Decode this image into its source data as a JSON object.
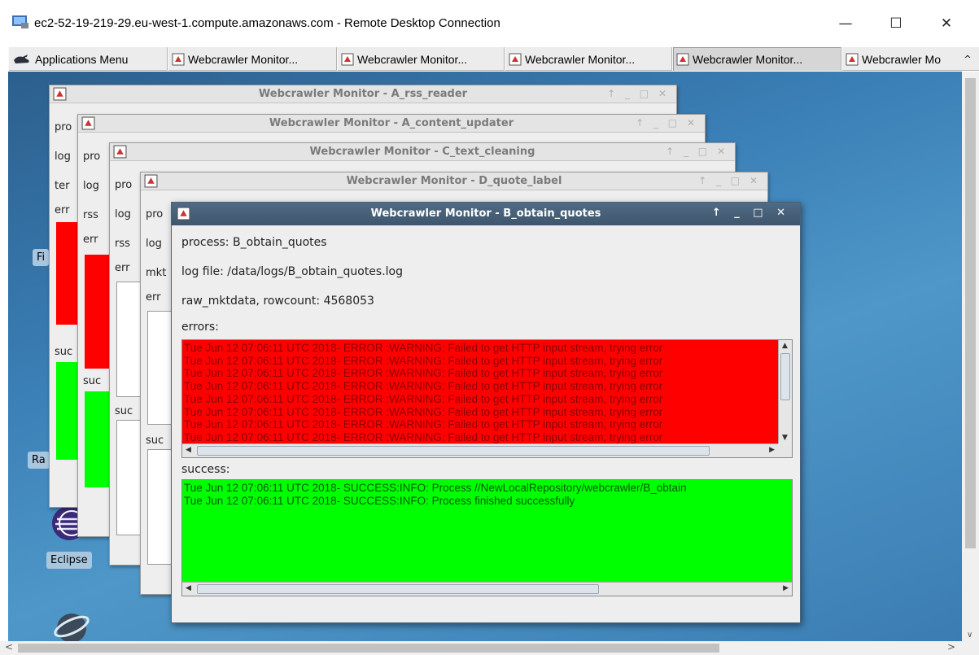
{
  "rdp": {
    "title": "ec2-52-19-219-29.eu-west-1.compute.amazonaws.com - Remote Desktop Connection",
    "minimize": "—",
    "maximize": "☐",
    "close": "✕"
  },
  "taskbar": {
    "apps_menu": "Applications Menu",
    "tasks": [
      "Webcrawler Monitor...",
      "Webcrawler Monitor...",
      "Webcrawler Monitor...",
      "Webcrawler Monitor...",
      "Webcrawler Mo"
    ]
  },
  "desktop": {
    "icons": [
      {
        "label": "Fi"
      },
      {
        "label": "Ra"
      },
      {
        "label": "Eclipse"
      }
    ]
  },
  "windows": {
    "w1": {
      "title": "Webcrawler Monitor - A_rss_reader",
      "peeks": [
        "pro",
        "log",
        "ter",
        "err",
        "suc"
      ]
    },
    "w2": {
      "title": "Webcrawler Monitor - A_content_updater",
      "peeks": [
        "pro",
        "log",
        "rss",
        "err",
        "suc"
      ]
    },
    "w3": {
      "title": "Webcrawler Monitor - C_text_cleaning",
      "peeks": [
        "pro",
        "log",
        "rss",
        "err",
        "suc"
      ]
    },
    "w4": {
      "title": "Webcrawler Monitor - D_quote_label",
      "peeks": [
        "pro",
        "log",
        "mkt",
        "err",
        "suc"
      ]
    },
    "w2_title_controls": "↑ _ □ ✕"
  },
  "active": {
    "title": "Webcrawler Monitor - B_obtain_quotes",
    "controls": "↑ _ □ ✕",
    "process": "process: B_obtain_quotes",
    "logfile": "log file: /data/logs/B_obtain_quotes.log",
    "rowcount": "raw_mktdata, rowcount: 4568053",
    "errors_label": "errors:",
    "errors": [
      "Tue Jun 12 07:06:11 UTC 2018- ERROR :WARNING: Failed to get HTTP input stream, trying error",
      "Tue Jun 12 07:06:11 UTC 2018- ERROR :WARNING: Failed to get HTTP input stream, trying error",
      "Tue Jun 12 07:06:11 UTC 2018- ERROR :WARNING: Failed to get HTTP input stream, trying error",
      "Tue Jun 12 07:06:11 UTC 2018- ERROR :WARNING: Failed to get HTTP input stream, trying error",
      "Tue Jun 12 07:06:11 UTC 2018- ERROR :WARNING: Failed to get HTTP input stream, trying error",
      "Tue Jun 12 07:06:11 UTC 2018- ERROR :WARNING: Failed to get HTTP input stream, trying error",
      "Tue Jun 12 07:06:11 UTC 2018- ERROR :WARNING: Failed to get HTTP input stream, trying error",
      "Tue Jun 12 07:06:11 UTC 2018- ERROR :WARNING: Failed to get HTTP input stream, trying error"
    ],
    "success_label": "success:",
    "success": [
      "Tue Jun 12 07:06:11 UTC 2018- SUCCESS:INFO: Process //NewLocalRepository/webcrawler/B_obtain",
      "Tue Jun 12 07:06:11 UTC 2018- SUCCESS:INFO: Process finished successfully"
    ]
  },
  "colors": {
    "error_bg": "#ff0000",
    "error_text": "#8b0000",
    "success_bg": "#00ff00",
    "success_text": "#005a00"
  }
}
